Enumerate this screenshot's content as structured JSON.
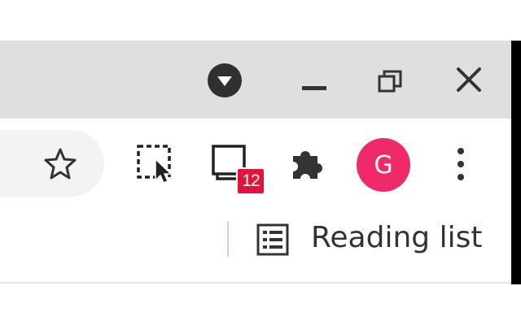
{
  "titlebar": {
    "buttons": [
      {
        "name": "tab-search",
        "icon": "chevron-down-circle-icon"
      },
      {
        "name": "minimize",
        "icon": "minimize-icon"
      },
      {
        "name": "restore",
        "icon": "restore-icon"
      },
      {
        "name": "close",
        "icon": "close-icon"
      }
    ]
  },
  "toolbar": {
    "bookmark_icon": "star-icon",
    "selection_tool_icon": "dashed-selection-cursor-icon",
    "tab_counter": {
      "icon": "tabs-icon",
      "badge": "12",
      "badge_color": "#e2133c"
    },
    "extensions_icon": "puzzle-icon",
    "profile": {
      "initial": "G",
      "color": "#ee2b68"
    },
    "menu_icon": "kebab-menu-icon"
  },
  "bookmarks_bar": {
    "reading_list": {
      "icon": "list-icon",
      "label": "Reading list"
    }
  },
  "colors": {
    "titlebar_bg": "#dfdfdf",
    "toolbar_bg": "#ffffff",
    "icon": "#333333"
  }
}
